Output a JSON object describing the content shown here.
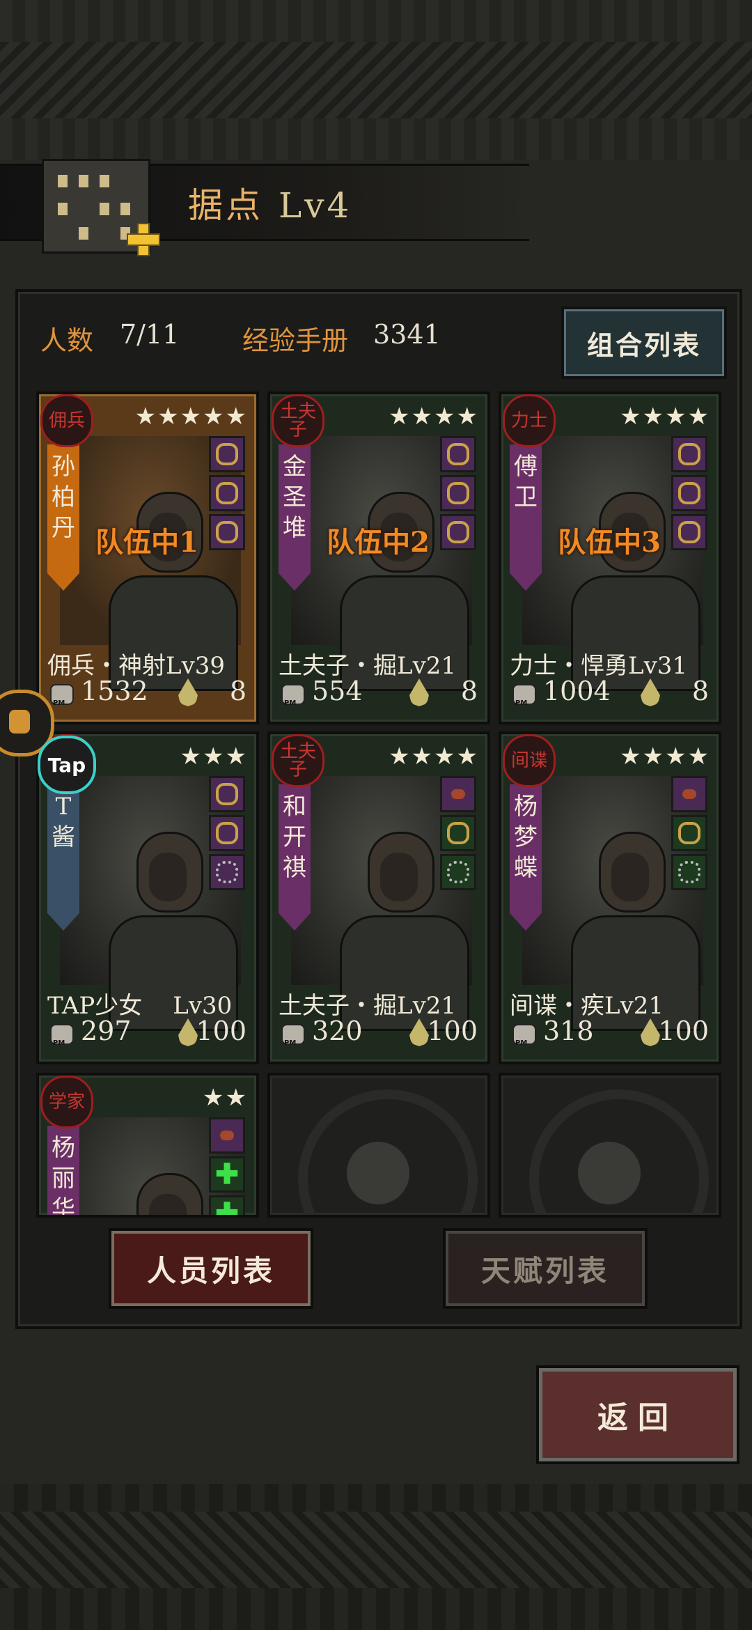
{
  "header": {
    "title": "据点",
    "level": "Lv4"
  },
  "stats": {
    "people_label": "人数",
    "people_value": "7/11",
    "exp_label": "经验手册",
    "exp_value": "3341",
    "combo_button": "组合列表"
  },
  "cards": [
    {
      "badge": "佣兵",
      "name_chars": [
        "孙",
        "柏",
        "丹"
      ],
      "stars": "★★★★★",
      "squad": "队伍中1",
      "class_name": "佣兵・神射",
      "level": "Lv39",
      "power": "1532",
      "mood": "8",
      "selected": true,
      "namebar": "orange",
      "equips": [
        "ring",
        "ring",
        "ring"
      ],
      "equip_color": "purple"
    },
    {
      "badge": "土夫子",
      "name_chars": [
        "金",
        "圣",
        "堆"
      ],
      "stars": "★★★★",
      "squad": "队伍中2",
      "class_name": "土夫子・掘",
      "level": "Lv21",
      "power": "554",
      "mood": "8",
      "selected": false,
      "namebar": "purple",
      "equips": [
        "ring",
        "ring",
        "ring"
      ],
      "equip_color": "purple"
    },
    {
      "badge": "力士",
      "name_chars": [
        "傅",
        "卫"
      ],
      "stars": "★★★★",
      "squad": "队伍中3",
      "class_name": "力士・悍勇",
      "level": "Lv31",
      "power": "1004",
      "mood": "8",
      "selected": false,
      "namebar": "purple",
      "equips": [
        "ring",
        "ring",
        "ring"
      ],
      "equip_color": "purple"
    },
    {
      "badge": "Tap",
      "name_chars": [
        "T",
        "酱"
      ],
      "stars": "★★★",
      "squad": "",
      "class_name": "TAP少女",
      "level": "Lv30",
      "power": "297",
      "mood": "100",
      "selected": false,
      "namebar": "blue",
      "equips": [
        "ring",
        "ring",
        "cog"
      ],
      "equip_color": "purple"
    },
    {
      "badge": "土夫子",
      "name_chars": [
        "和",
        "开",
        "祺"
      ],
      "stars": "★★★★",
      "squad": "",
      "class_name": "土夫子・掘",
      "level": "Lv21",
      "power": "320",
      "mood": "100",
      "selected": false,
      "namebar": "purple",
      "equips": [
        "bug",
        "ring",
        "cog"
      ],
      "equip_color": "green"
    },
    {
      "badge": "间谍",
      "name_chars": [
        "杨",
        "梦",
        "蝶"
      ],
      "stars": "★★★★",
      "squad": "",
      "class_name": "间谍・疾",
      "level": "Lv21",
      "power": "318",
      "mood": "100",
      "selected": false,
      "namebar": "purple",
      "equips": [
        "bug",
        "ring",
        "cog"
      ],
      "equip_color": "green"
    },
    {
      "badge": "学家",
      "name_chars": [
        "杨",
        "丽",
        "华"
      ],
      "stars": "★★",
      "squad": "",
      "class_name": "",
      "level": "",
      "power": "",
      "mood": "",
      "selected": false,
      "namebar": "purple",
      "equips": [
        "bug",
        "plus",
        "plus"
      ],
      "equip_color": "purple"
    }
  ],
  "buttons": {
    "staff_list": "人员列表",
    "talent_list": "天赋列表",
    "back": "返回"
  },
  "side": {
    "tap_label": "Tap"
  }
}
